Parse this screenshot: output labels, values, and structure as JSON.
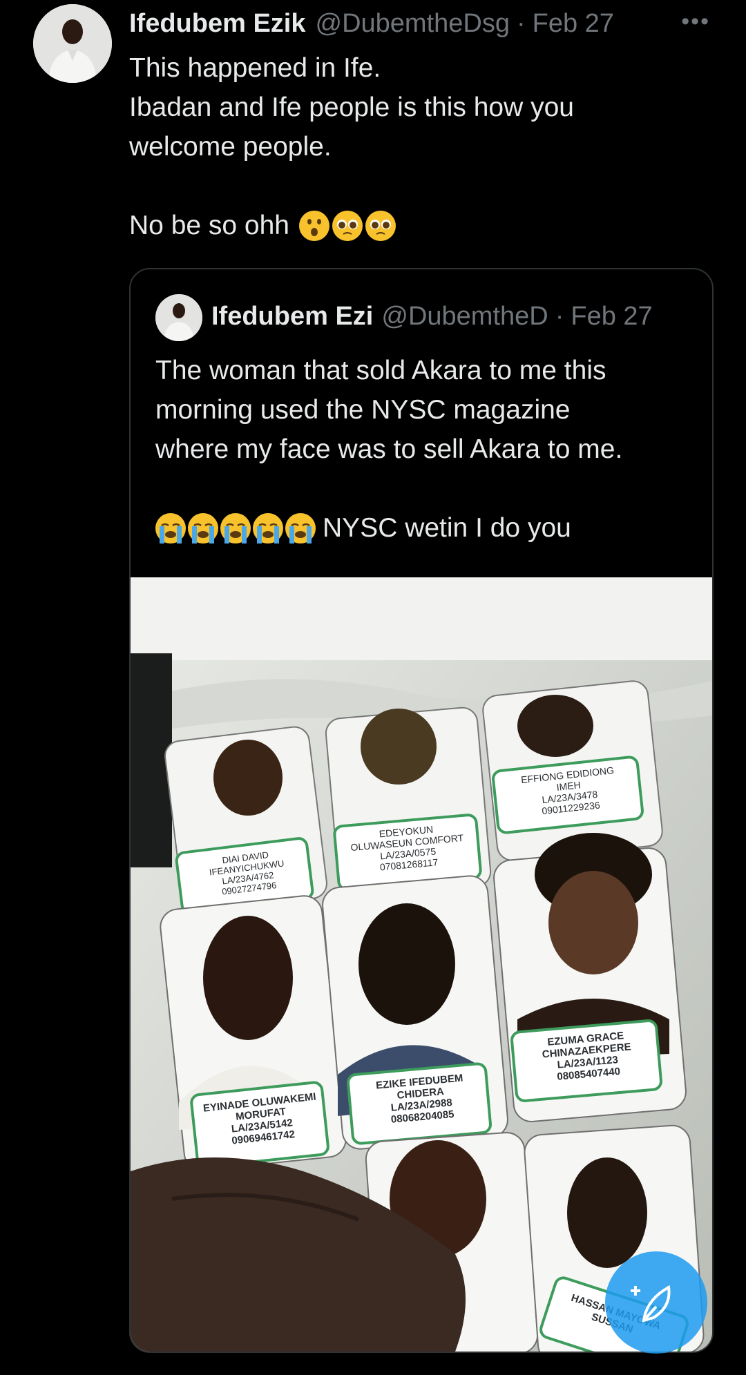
{
  "tweet": {
    "author_name": "Ifedubem Ezik",
    "author_handle": "@DubemtheDsg",
    "separator": "·",
    "date": "Feb 27",
    "more_label": "•••",
    "lines": [
      "This happened in Ife.",
      "Ibadan and Ife people is this how you",
      "welcome people."
    ],
    "last_line": "No be so ohh",
    "emojis": [
      "astonished-face-icon",
      "pleading-face-icon",
      "pleading-face-icon"
    ]
  },
  "quoted_tweet": {
    "author_name": "Ifedubem Ezi",
    "author_handle": "@DubemtheD",
    "separator": "·",
    "date": "Feb 27",
    "lines": [
      "The woman that sold Akara to me this",
      "morning used the NYSC magazine",
      "where my face was to sell Akara to me."
    ],
    "last_line_emojis": [
      "crying-face-icon",
      "crying-face-icon",
      "crying-face-icon",
      "crying-face-icon",
      "crying-face-icon"
    ],
    "last_line": "NYSC wetin I do you"
  },
  "photo": {
    "cards": [
      {
        "lines": [
          "DIAI DAVID",
          "IFEANYICHUKWU",
          "LA/23A/4762",
          "09027274796"
        ]
      },
      {
        "lines": [
          "EDEYOKUN",
          "OLUWASEUN COMFORT",
          "LA/23A/0575",
          "07081268117"
        ]
      },
      {
        "lines": [
          "EFFIONG EDIDIONG",
          "IMEH",
          "LA/23A/3478",
          "09011229236"
        ]
      },
      {
        "lines": [
          "EYINADE OLUWAKEMI",
          "MORUFAT",
          "LA/23A/5142",
          "09069461742"
        ]
      },
      {
        "lines": [
          "EZIKE IFEDUBEM",
          "CHIDERA",
          "LA/23A/2988",
          "08068204085"
        ]
      },
      {
        "lines": [
          "EZUMA GRACE",
          "CHINAZAEKPERE",
          "LA/23A/1123",
          "08085407440"
        ]
      },
      {
        "lines": [
          "HASSAN MAYOWA",
          "SUSSAN"
        ]
      }
    ]
  },
  "colors": {
    "background": "#000000",
    "text_primary": "#e7e9ea",
    "text_secondary": "#71767b",
    "border": "#2f3336",
    "accent": "#1d9bf0",
    "card_green": "#3d9b5c"
  },
  "fab_icon": "compose-post-icon"
}
